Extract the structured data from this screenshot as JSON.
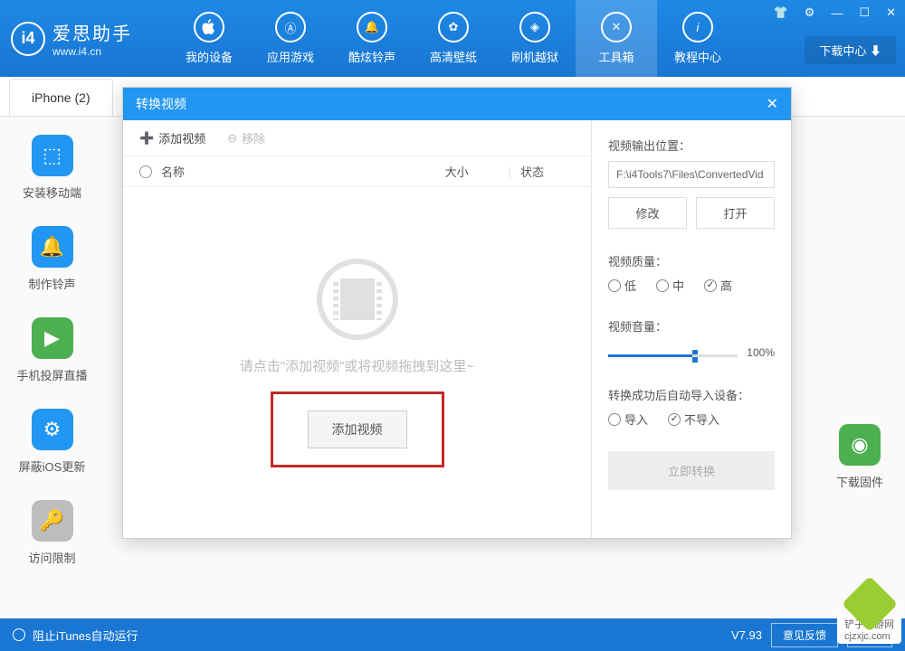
{
  "header": {
    "logo_letter": "i4",
    "title": "爱思助手",
    "subtitle": "www.i4.cn",
    "download_center": "下载中心"
  },
  "nav": [
    {
      "label": "我的设备"
    },
    {
      "label": "应用游戏"
    },
    {
      "label": "酷炫铃声"
    },
    {
      "label": "高清壁纸"
    },
    {
      "label": "刷机越狱"
    },
    {
      "label": "工具箱",
      "active": true
    },
    {
      "label": "教程中心"
    }
  ],
  "tab": {
    "label": "iPhone (2)"
  },
  "sidebar": [
    {
      "label": "安装移动端",
      "bg": "#2196f3"
    },
    {
      "label": "制作铃声",
      "bg": "#2196f3"
    },
    {
      "label": "手机投屏直播",
      "bg": "#4caf50"
    },
    {
      "label": "屏蔽iOS更新",
      "bg": "#2196f3"
    },
    {
      "label": "访问限制",
      "bg": "#bdbdbd"
    }
  ],
  "rightbar": [
    {
      "label": "下载固件",
      "bg": "#4caf50"
    }
  ],
  "modal": {
    "title": "转换视频",
    "toolbar": {
      "add": "添加视频",
      "remove": "移除"
    },
    "columns": {
      "name": "名称",
      "size": "大小",
      "status": "状态"
    },
    "dropzone_hint": "请点击\"添加视频\"或将视频拖拽到这里~",
    "add_button": "添加视频",
    "output_label": "视频输出位置：",
    "output_path": "F:\\i4Tools7\\Files\\ConvertedVid",
    "modify": "修改",
    "open": "打开",
    "quality_label": "视频质量：",
    "quality": {
      "low": "低",
      "mid": "中",
      "high": "高"
    },
    "volume_label": "视频音量：",
    "volume_value": "100%",
    "import_label": "转换成功后自动导入设备：",
    "import_opts": {
      "yes": "导入",
      "no": "不导入"
    },
    "convert_btn": "立即转换"
  },
  "status": {
    "itunes": "阻止iTunes自动运行",
    "version": "V7.93",
    "feedback": "意见反馈",
    "wechat": "微信"
  },
  "watermark": "铲子手游网\ncjzxjc.com"
}
